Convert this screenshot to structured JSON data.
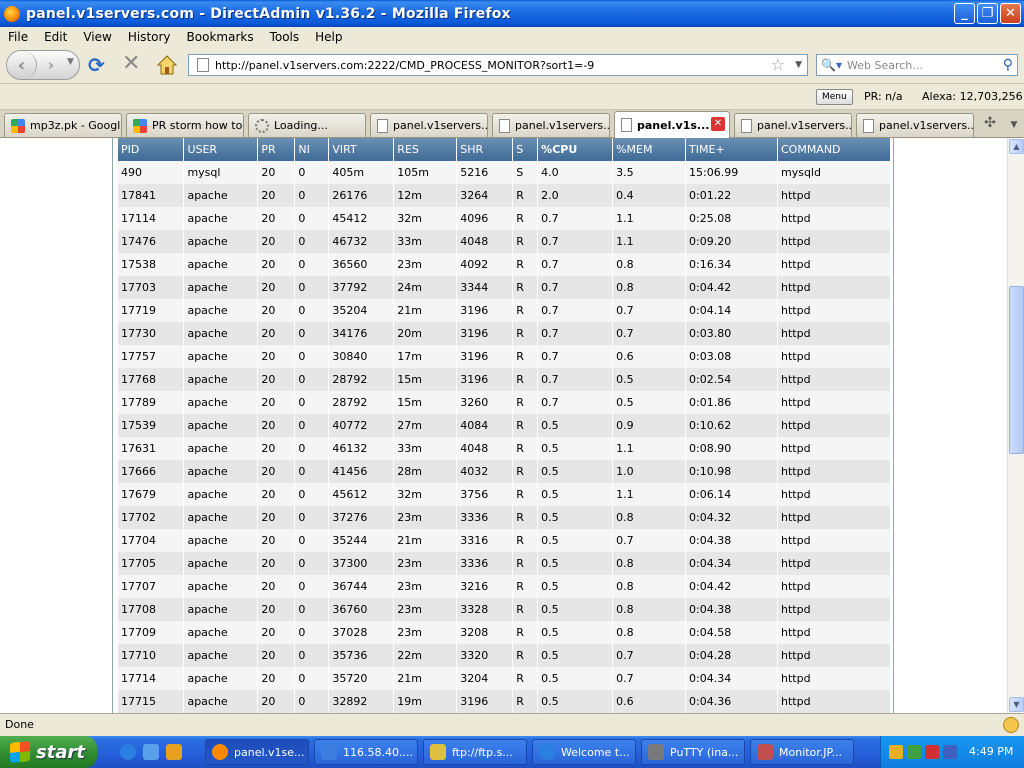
{
  "window": {
    "title": "panel.v1servers.com - DirectAdmin v1.36.2 - Mozilla Firefox"
  },
  "menu": [
    "File",
    "Edit",
    "View",
    "History",
    "Bookmarks",
    "Tools",
    "Help"
  ],
  "nav": {
    "url": "http://panel.v1servers.com:2222/CMD_PROCESS_MONITOR?sort1=-9",
    "search_placeholder": "Web Search..."
  },
  "extra_toolbar": {
    "menu_label": "Menu",
    "pr": "PR: n/a",
    "alexa": "Alexa: 12,703,256"
  },
  "tabs": [
    {
      "label": "mp3z.pk - Googl...",
      "icon": "google"
    },
    {
      "label": "PR storm how to...",
      "icon": "google"
    },
    {
      "label": "Loading...",
      "icon": "loading"
    },
    {
      "label": "panel.v1servers...",
      "icon": "page"
    },
    {
      "label": "panel.v1servers...",
      "icon": "page"
    },
    {
      "label": "panel.v1s...",
      "icon": "page",
      "active": true
    },
    {
      "label": "panel.v1servers...",
      "icon": "page"
    },
    {
      "label": "panel.v1servers...",
      "icon": "page"
    }
  ],
  "table": {
    "columns": [
      "PID",
      "USER",
      "PR",
      "NI",
      "VIRT",
      "RES",
      "SHR",
      "S",
      "%CPU",
      "%MEM",
      "TIME+",
      "COMMAND"
    ],
    "sorted_column": "%CPU",
    "rows": [
      [
        "490",
        "mysql",
        "20",
        "0",
        "405m",
        "105m",
        "5216",
        "S",
        "4.0",
        "3.5",
        "15:06.99",
        "mysqld"
      ],
      [
        "17841",
        "apache",
        "20",
        "0",
        "26176",
        "12m",
        "3264",
        "R",
        "2.0",
        "0.4",
        "0:01.22",
        "httpd"
      ],
      [
        "17114",
        "apache",
        "20",
        "0",
        "45412",
        "32m",
        "4096",
        "R",
        "0.7",
        "1.1",
        "0:25.08",
        "httpd"
      ],
      [
        "17476",
        "apache",
        "20",
        "0",
        "46732",
        "33m",
        "4048",
        "R",
        "0.7",
        "1.1",
        "0:09.20",
        "httpd"
      ],
      [
        "17538",
        "apache",
        "20",
        "0",
        "36560",
        "23m",
        "4092",
        "R",
        "0.7",
        "0.8",
        "0:16.34",
        "httpd"
      ],
      [
        "17703",
        "apache",
        "20",
        "0",
        "37792",
        "24m",
        "3344",
        "R",
        "0.7",
        "0.8",
        "0:04.42",
        "httpd"
      ],
      [
        "17719",
        "apache",
        "20",
        "0",
        "35204",
        "21m",
        "3196",
        "R",
        "0.7",
        "0.7",
        "0:04.14",
        "httpd"
      ],
      [
        "17730",
        "apache",
        "20",
        "0",
        "34176",
        "20m",
        "3196",
        "R",
        "0.7",
        "0.7",
        "0:03.80",
        "httpd"
      ],
      [
        "17757",
        "apache",
        "20",
        "0",
        "30840",
        "17m",
        "3196",
        "R",
        "0.7",
        "0.6",
        "0:03.08",
        "httpd"
      ],
      [
        "17768",
        "apache",
        "20",
        "0",
        "28792",
        "15m",
        "3196",
        "R",
        "0.7",
        "0.5",
        "0:02.54",
        "httpd"
      ],
      [
        "17789",
        "apache",
        "20",
        "0",
        "28792",
        "15m",
        "3260",
        "R",
        "0.7",
        "0.5",
        "0:01.86",
        "httpd"
      ],
      [
        "17539",
        "apache",
        "20",
        "0",
        "40772",
        "27m",
        "4084",
        "R",
        "0.5",
        "0.9",
        "0:10.62",
        "httpd"
      ],
      [
        "17631",
        "apache",
        "20",
        "0",
        "46132",
        "33m",
        "4048",
        "R",
        "0.5",
        "1.1",
        "0:08.90",
        "httpd"
      ],
      [
        "17666",
        "apache",
        "20",
        "0",
        "41456",
        "28m",
        "4032",
        "R",
        "0.5",
        "1.0",
        "0:10.98",
        "httpd"
      ],
      [
        "17679",
        "apache",
        "20",
        "0",
        "45612",
        "32m",
        "3756",
        "R",
        "0.5",
        "1.1",
        "0:06.14",
        "httpd"
      ],
      [
        "17702",
        "apache",
        "20",
        "0",
        "37276",
        "23m",
        "3336",
        "R",
        "0.5",
        "0.8",
        "0:04.32",
        "httpd"
      ],
      [
        "17704",
        "apache",
        "20",
        "0",
        "35244",
        "21m",
        "3316",
        "R",
        "0.5",
        "0.7",
        "0:04.38",
        "httpd"
      ],
      [
        "17705",
        "apache",
        "20",
        "0",
        "37300",
        "23m",
        "3336",
        "R",
        "0.5",
        "0.8",
        "0:04.34",
        "httpd"
      ],
      [
        "17707",
        "apache",
        "20",
        "0",
        "36744",
        "23m",
        "3216",
        "R",
        "0.5",
        "0.8",
        "0:04.42",
        "httpd"
      ],
      [
        "17708",
        "apache",
        "20",
        "0",
        "36760",
        "23m",
        "3328",
        "R",
        "0.5",
        "0.8",
        "0:04.38",
        "httpd"
      ],
      [
        "17709",
        "apache",
        "20",
        "0",
        "37028",
        "23m",
        "3208",
        "R",
        "0.5",
        "0.8",
        "0:04.58",
        "httpd"
      ],
      [
        "17710",
        "apache",
        "20",
        "0",
        "35736",
        "22m",
        "3320",
        "R",
        "0.5",
        "0.7",
        "0:04.28",
        "httpd"
      ],
      [
        "17714",
        "apache",
        "20",
        "0",
        "35720",
        "21m",
        "3204",
        "R",
        "0.5",
        "0.7",
        "0:04.34",
        "httpd"
      ],
      [
        "17715",
        "apache",
        "20",
        "0",
        "32892",
        "19m",
        "3196",
        "R",
        "0.5",
        "0.6",
        "0:04.36",
        "httpd"
      ]
    ]
  },
  "status": {
    "text": "Done"
  },
  "taskbar": {
    "start_label": "start",
    "buttons": [
      {
        "label": "panel.v1se...",
        "icon_color": "#ff8a00",
        "active": true
      },
      {
        "label": "116.58.40....",
        "icon_color": "#3b7de0"
      },
      {
        "label": "ftp://ftp.s...",
        "icon_color": "#e0c040"
      },
      {
        "label": "Welcome t...",
        "icon_color": "#2a7fe0"
      },
      {
        "label": "PuTTY (ina...",
        "icon_color": "#7a7a7a"
      },
      {
        "label": "Monitor.JP...",
        "icon_color": "#c05050"
      }
    ],
    "clock": "4:49 PM"
  },
  "colors": {
    "header_bg": "#4f7aa3",
    "row_odd": "#f5f5f5",
    "row_even": "#e6e6e6",
    "taskbar": "#245edb"
  }
}
